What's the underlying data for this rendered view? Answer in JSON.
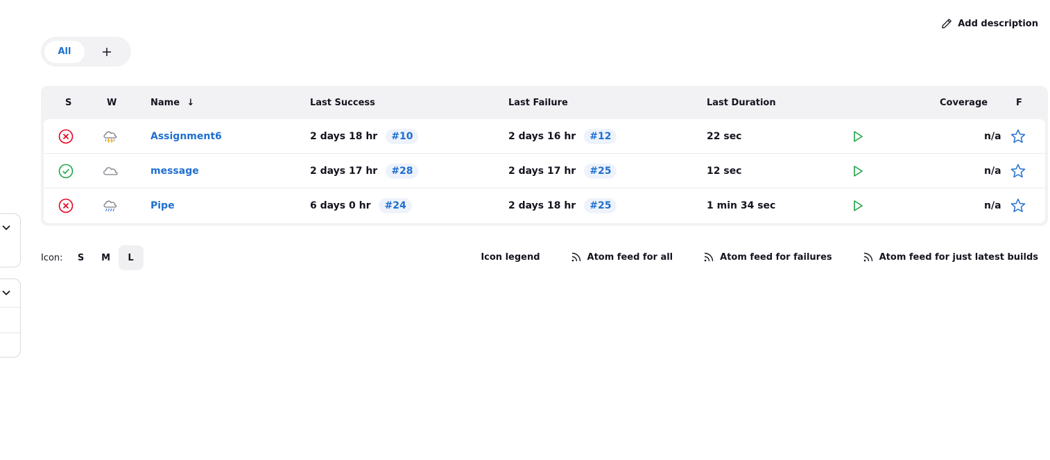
{
  "header": {
    "add_description": "Add description",
    "add_description_icon": "pencil-icon"
  },
  "tabs": {
    "items": [
      {
        "label": "All",
        "active": true
      }
    ],
    "add_icon": "plus-icon"
  },
  "table": {
    "columns": {
      "s": "S",
      "w": "W",
      "name": "Name",
      "name_sort": "↓",
      "last_success": "Last Success",
      "last_failure": "Last Failure",
      "last_duration": "Last Duration",
      "coverage": "Coverage",
      "f": "F"
    },
    "rows": [
      {
        "status": "failed",
        "status_icon": "failed-circle-icon",
        "weather_icon": "thunderstorm-icon",
        "name": "Assignment6",
        "last_success": "2 days 18 hr",
        "last_success_build": "#10",
        "last_failure": "2 days 16 hr",
        "last_failure_build": "#12",
        "last_duration": "22 sec",
        "coverage": "n/a"
      },
      {
        "status": "success",
        "status_icon": "success-circle-icon",
        "weather_icon": "cloudy-icon",
        "name": "message",
        "last_success": "2 days 17 hr",
        "last_success_build": "#28",
        "last_failure": "2 days 17 hr",
        "last_failure_build": "#25",
        "last_duration": "12 sec",
        "coverage": "n/a"
      },
      {
        "status": "failed",
        "status_icon": "failed-circle-icon",
        "weather_icon": "rain-icon",
        "name": "Pipe",
        "last_success": "6 days 0 hr",
        "last_success_build": "#24",
        "last_failure": "2 days 18 hr",
        "last_failure_build": "#25",
        "last_duration": "1 min 34 sec",
        "coverage": "n/a"
      }
    ]
  },
  "footer": {
    "icon_label": "Icon:",
    "sizes": [
      "S",
      "M",
      "L"
    ],
    "active_size": "L",
    "links": [
      "Icon legend",
      "Atom feed for all",
      "Atom feed for failures",
      "Atom feed for just latest builds"
    ]
  },
  "colors": {
    "accent": "#1f6fcf",
    "success": "#1ea446",
    "failure": "#e6001f",
    "weather_bolt": "#f0a800",
    "rain": "#4a7fd4"
  }
}
